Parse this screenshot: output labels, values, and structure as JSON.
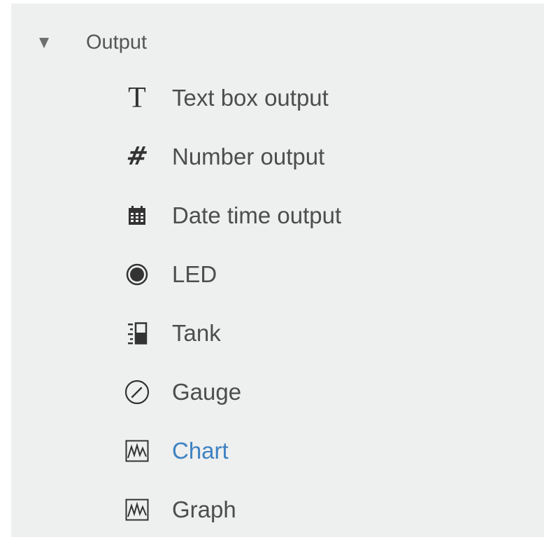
{
  "section": {
    "label": "Output",
    "expanded": true
  },
  "items": [
    {
      "label": "Text box output",
      "icon": "text-t-icon"
    },
    {
      "label": "Number output",
      "icon": "hash-icon"
    },
    {
      "label": "Date time output",
      "icon": "calendar-icon"
    },
    {
      "label": "LED",
      "icon": "led-icon"
    },
    {
      "label": "Tank",
      "icon": "tank-icon"
    },
    {
      "label": "Gauge",
      "icon": "gauge-icon"
    },
    {
      "label": "Chart",
      "icon": "chart-icon",
      "active": true
    },
    {
      "label": "Graph",
      "icon": "graph-icon"
    }
  ],
  "colors": {
    "panel_background": "#eeefef",
    "label_text": "#4d4d4d",
    "active_label": "#3e82c2",
    "icon": "#333333"
  }
}
